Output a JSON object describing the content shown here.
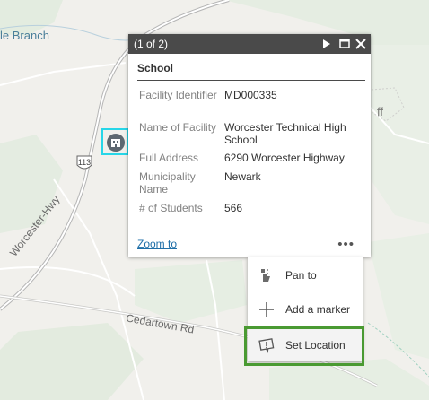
{
  "map": {
    "water_label": "le Branch",
    "route_number": "113",
    "road_worcester": "Worcester-Hwy",
    "road_cedartown": "Cedartown  Rd",
    "partial_label": "ff"
  },
  "popup": {
    "count": "(1 of 2)",
    "title": "School",
    "attributes": [
      {
        "label": "Facility Identifier",
        "value": "MD000335"
      },
      {
        "label": "Name of Facility",
        "value": "Worcester Technical High School"
      },
      {
        "label": "Full Address",
        "value": "6290 Worcester Highway"
      },
      {
        "label": "Municipality Name",
        "value": "Newark"
      },
      {
        "label": "# of Students",
        "value": "566"
      }
    ],
    "zoom_label": "Zoom to",
    "more_label": "•••"
  },
  "menu": {
    "items": [
      {
        "label": "Pan to",
        "icon": "pan-icon"
      },
      {
        "label": "Add a marker",
        "icon": "plus-icon"
      },
      {
        "label": "Set Location",
        "icon": "warning-marker-icon"
      }
    ]
  },
  "colors": {
    "header": "#4a4a4a",
    "link": "#1f6fa8",
    "focus": "#4a9a32",
    "selection": "#27d6e8"
  }
}
